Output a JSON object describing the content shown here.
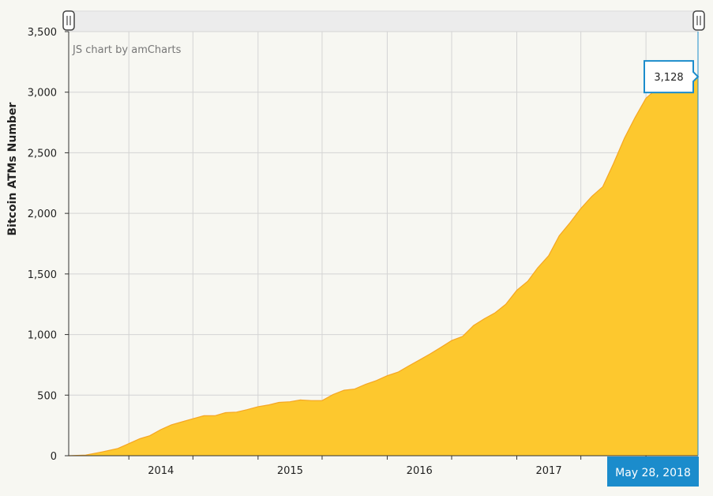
{
  "chart_data": {
    "type": "area",
    "credit": "JS chart by amCharts",
    "ylabel": "Bitcoin ATMs Number",
    "xlabel": "",
    "ylim": [
      0,
      3500
    ],
    "y_ticks": [
      "0",
      "500",
      "1,000",
      "1,500",
      "2,000",
      "2,500",
      "3,000",
      "3,500"
    ],
    "y_tick_values": [
      0,
      500,
      1000,
      1500,
      2000,
      2500,
      3000,
      3500
    ],
    "x_range": [
      "2013-07-15",
      "2018-05-28"
    ],
    "x_ticks": [
      "2014",
      "2015",
      "2016",
      "2017"
    ],
    "x_tick_dates": [
      "2014-01-01",
      "2015-01-01",
      "2016-01-01",
      "2017-01-01"
    ],
    "grid": true,
    "series": [
      {
        "x": [
          "2013-07-15",
          "2013-09-01",
          "2013-10-15",
          "2013-12-01",
          "2014-01-01",
          "2014-02-01",
          "2014-03-01",
          "2014-04-01",
          "2014-05-01",
          "2014-06-01",
          "2014-07-01",
          "2014-08-01",
          "2014-09-01",
          "2014-10-01",
          "2014-11-01",
          "2014-12-01",
          "2015-01-01",
          "2015-02-01",
          "2015-03-01",
          "2015-04-01",
          "2015-05-01",
          "2015-06-01",
          "2015-07-01",
          "2015-08-01",
          "2015-09-01",
          "2015-10-01",
          "2015-11-01",
          "2015-12-01",
          "2016-01-01",
          "2016-02-01",
          "2016-03-01",
          "2016-04-01",
          "2016-05-01",
          "2016-06-01",
          "2016-07-01",
          "2016-08-01",
          "2016-09-01",
          "2016-10-01",
          "2016-11-01",
          "2016-12-01",
          "2017-01-01",
          "2017-02-01",
          "2017-03-01",
          "2017-04-01",
          "2017-05-01",
          "2017-06-01",
          "2017-07-01",
          "2017-08-01",
          "2017-09-01",
          "2017-10-01",
          "2017-11-01",
          "2017-12-01",
          "2018-01-01",
          "2018-02-01",
          "2018-03-01",
          "2018-04-01",
          "2018-05-28"
        ],
        "values": [
          0,
          5,
          30,
          60,
          100,
          140,
          165,
          215,
          255,
          280,
          305,
          330,
          330,
          355,
          360,
          380,
          405,
          420,
          440,
          445,
          460,
          455,
          455,
          505,
          540,
          550,
          590,
          620,
          660,
          690,
          740,
          790,
          840,
          895,
          950,
          985,
          1075,
          1130,
          1180,
          1250,
          1365,
          1440,
          1550,
          1650,
          1815,
          1925,
          2040,
          2140,
          2220,
          2410,
          2620,
          2790,
          2950,
          3030,
          3080,
          3100,
          3128
        ]
      }
    ],
    "cursor": {
      "date_label": "May 28, 2018",
      "value_label": "3,128"
    },
    "colors": {
      "fill": "#fdc82e",
      "line": "#f5a623",
      "cursor": "#1b8ccc",
      "grid": "#d4d4d4",
      "axis": "#333333"
    }
  }
}
